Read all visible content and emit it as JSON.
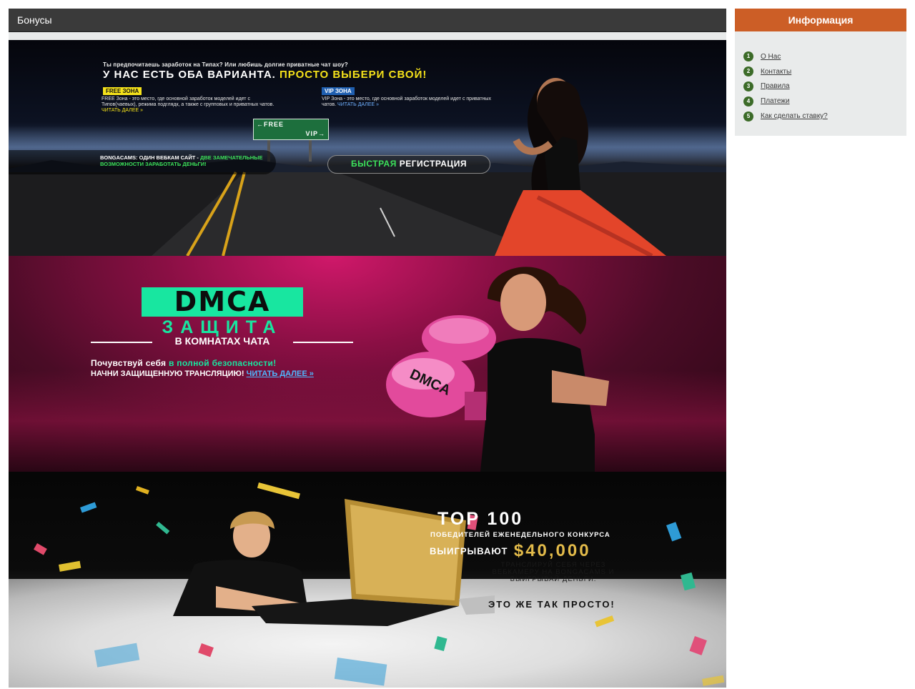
{
  "main": {
    "section_title": "Бонусы",
    "banners": [
      {
        "id": "choose-zone",
        "question": "Ты предпочитаешь заработок на Типах? Или любишь долгие приватные чат шоу?",
        "headline_part1": "У НАС ЕСТЬ ОБА ВАРИАНТА.",
        "headline_part2": "ПРОСТО ВЫБЕРИ СВОЙ!",
        "free_tag": "FREE ЗОНА",
        "free_desc": "FREE Зона - это место, где основной заработок моделей идет с Типов(чаевых), режима подглядк, а также с групповых и приватных чатов.",
        "free_read_more": "ЧИТАТЬ ДАЛЕЕ »",
        "vip_tag": "VIP ЗОНА",
        "vip_desc": "VIP Зона - это место, где основной заработок моделей идет с приватных чатов.",
        "vip_read_more": "ЧИТАТЬ ДАЛЕЕ »",
        "sign_free": "←FREE",
        "sign_vip": "VIP→",
        "bottom_left_part1": "BONGACAMS: ОДИН ВЕБКАМ САЙТ -",
        "bottom_left_part2": "ДВЕ ЗАМЕЧАТЕЛЬНЫЕ ВОЗМОЖНОСТИ ЗАРАБОТАТЬ ДЕНЬГИ!",
        "reg_part1": "БЫСТРАЯ",
        "reg_part2": "РЕГИСТРАЦИЯ"
      },
      {
        "id": "dmca",
        "logo": "DMCA",
        "title": "ЗАЩИТА",
        "subtitle": "В КОМНАТАХ ЧАТА",
        "line1_part1": "Почувствуй себя",
        "line1_part2": "в полной безопасности!",
        "line2": "НАЧНИ ЗАЩИЩЕННУЮ ТРАНСЛЯЦИЮ!",
        "read_more": "ЧИТАТЬ ДАЛЕЕ »",
        "glove_label": "DMCA"
      },
      {
        "id": "top100",
        "title": "TOP 100",
        "winners_line": "ПОБЕДИТЕЛЕЙ ЕЖЕНЕДЕЛЬНОГО КОНКУРСА",
        "win_word": "ВЫИГРЫВАЮТ",
        "amount": "$40,000",
        "stream_line1": "ТРАНСЛИРУЙ СЕБЯ ЧЕРЕЗ",
        "stream_line2": "ВЕБКАМЕРУ НА BONGACAMS И",
        "stream_line3": "ВЫИГРЫВАЙ ДЕНЬГИ.",
        "easy": "ЭТО ЖЕ ТАК ПРОСТО!"
      }
    ]
  },
  "sidebar": {
    "title": "Информация",
    "items": [
      {
        "num": "1",
        "label": "О Нас"
      },
      {
        "num": "2",
        "label": "Контакты"
      },
      {
        "num": "3",
        "label": "Правила"
      },
      {
        "num": "4",
        "label": "Платежи"
      },
      {
        "num": "5",
        "label": "Как сделать ставку?"
      }
    ]
  },
  "colors": {
    "header_bg": "#3a3a3a",
    "sidebar_header": "#cc5e26",
    "sidebar_bg": "#e9ebeb",
    "badge": "#3c6b28",
    "accent_yellow": "#f5e21a",
    "accent_green": "#18e6a0",
    "gold": "#e3bb4a"
  }
}
